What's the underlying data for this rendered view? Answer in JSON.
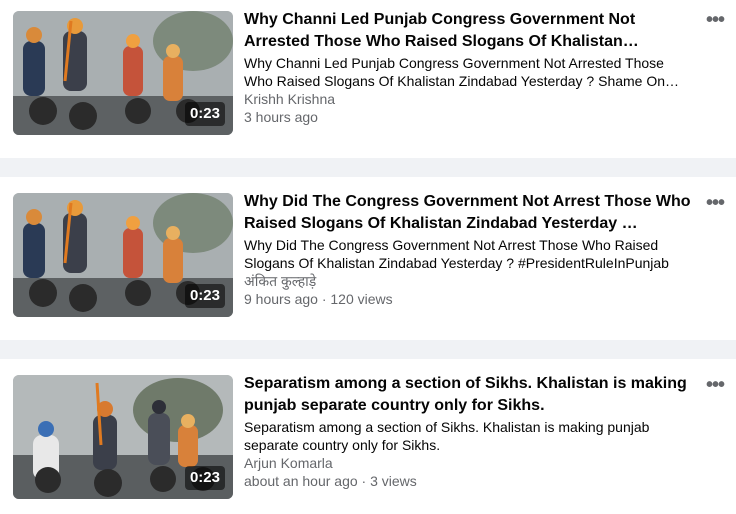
{
  "videos": [
    {
      "title": "Why Channi Led Punjab Congress Government Not Arrested Those Who Raised Slogans Of Khalistan…",
      "description": "Why Channi Led Punjab Congress Government Not Arrested Those Who Raised Slogans Of Khalistan Zindabad Yesterday ? Shame On…",
      "author": "Krishh Krishna",
      "time": "3 hours ago",
      "duration": "0:23",
      "more_icon": "more-horizontal-icon"
    },
    {
      "title": "Why Did The Congress Government Not Arrest Those Who Raised Slogans Of Khalistan Zindabad Yesterday …",
      "description": "Why Did The Congress Government Not Arrest Those Who Raised Slogans Of Khalistan Zindabad Yesterday ? #PresidentRuleInPunjab",
      "author": "अंकित कुल्हाड़े",
      "time": "9 hours ago · 120 views",
      "duration": "0:23",
      "more_icon": "more-horizontal-icon"
    },
    {
      "title": "Separatism among a section of Sikhs. Khalistan is making punjab separate country only for Sikhs.",
      "description": "Separatism among a section of Sikhs. Khalistan is making punjab separate country only for Sikhs.",
      "author": "Arjun Komarla",
      "time": "about an hour ago · 3 views",
      "duration": "0:23",
      "more_icon": "more-horizontal-icon"
    }
  ]
}
